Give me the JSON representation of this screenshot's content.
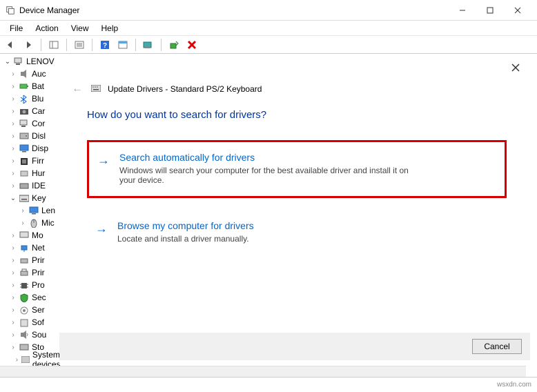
{
  "window": {
    "title": "Device Manager"
  },
  "menu": {
    "file": "File",
    "action": "Action",
    "view": "View",
    "help": "Help"
  },
  "tree": {
    "root": "LENOV",
    "items": [
      {
        "label": "Auc",
        "icon": "speaker"
      },
      {
        "label": "Bat",
        "icon": "battery"
      },
      {
        "label": "Blu",
        "icon": "bluetooth"
      },
      {
        "label": "Car",
        "icon": "camera"
      },
      {
        "label": "Cor",
        "icon": "computer"
      },
      {
        "label": "Disl",
        "icon": "disk"
      },
      {
        "label": "Disp",
        "icon": "display"
      },
      {
        "label": "Firr",
        "icon": "firmware"
      },
      {
        "label": "Hur",
        "icon": "hid"
      },
      {
        "label": "IDE",
        "icon": "ide"
      },
      {
        "label": "Key",
        "icon": "keyboard",
        "expanded": true
      },
      {
        "label": "Len",
        "icon": "display",
        "level": 2
      },
      {
        "label": "Mic",
        "icon": "mouse",
        "level": 2
      },
      {
        "label": "Mo",
        "icon": "monitor"
      },
      {
        "label": "Net",
        "icon": "network"
      },
      {
        "label": "Prir",
        "icon": "printq"
      },
      {
        "label": "Prir",
        "icon": "printer"
      },
      {
        "label": "Pro",
        "icon": "cpu"
      },
      {
        "label": "Sec",
        "icon": "security"
      },
      {
        "label": "Ser",
        "icon": "sensor"
      },
      {
        "label": "Sof",
        "icon": "software"
      },
      {
        "label": "Sou",
        "icon": "sound"
      },
      {
        "label": "Sto",
        "icon": "storage"
      }
    ],
    "last": "System devices"
  },
  "dialog": {
    "header": "Update Drivers - Standard PS/2 Keyboard",
    "question": "How do you want to search for drivers?",
    "opt1": {
      "title": "Search automatically for drivers",
      "desc": "Windows will search your computer for the best available driver and install it on your device."
    },
    "opt2": {
      "title": "Browse my computer for drivers",
      "desc": "Locate and install a driver manually."
    },
    "cancel": "Cancel"
  },
  "watermark": "wsxdn.com"
}
